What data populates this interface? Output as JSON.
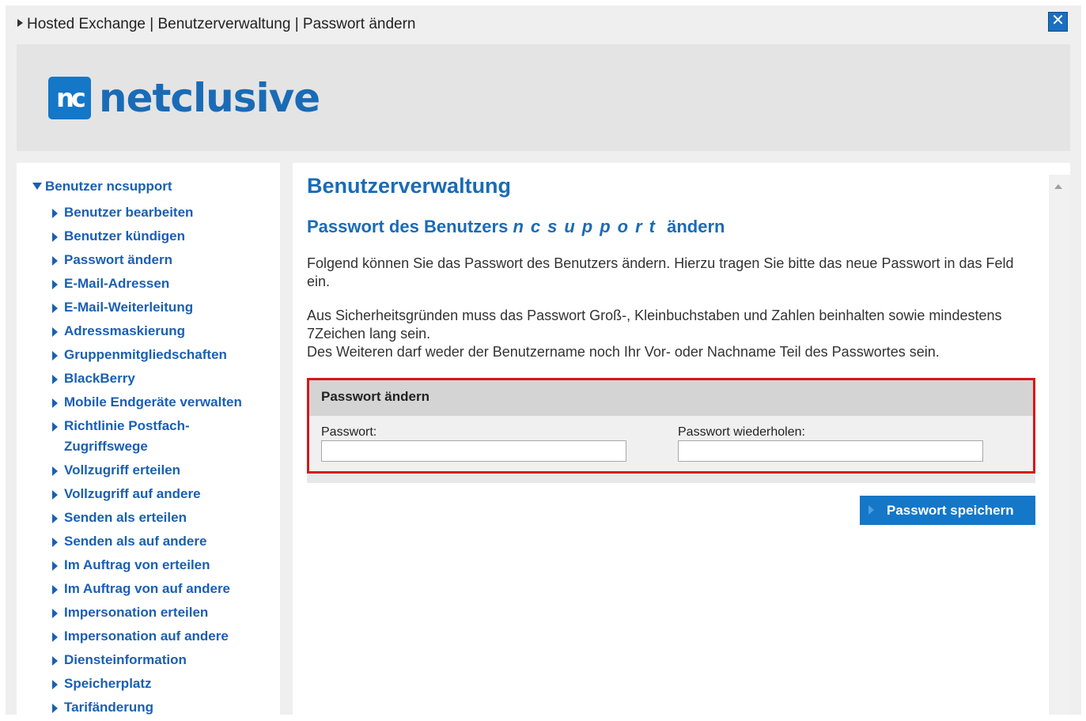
{
  "breadcrumb": "Hosted Exchange | Benutzerverwaltung | Passwort ändern",
  "close_label": "✕",
  "logo": {
    "mark": "nc",
    "text": "netclusive"
  },
  "sidebar": {
    "root_label": "Benutzer ncsupport",
    "items": [
      "Benutzer bearbeiten",
      "Benutzer kündigen",
      "Passwort ändern",
      "E-Mail-Adressen",
      "E-Mail-Weiterleitung",
      "Adressmaskierung",
      "Gruppenmitgliedschaften",
      "BlackBerry",
      "Mobile Endgeräte verwalten",
      "Richtlinie Postfach-Zugriffswege",
      "Vollzugriff erteilen",
      "Vollzugriff auf andere",
      "Senden als erteilen",
      "Senden als auf andere",
      "Im Auftrag von erteilen",
      "Im Auftrag von auf andere",
      "Impersonation erteilen",
      "Impersonation auf andere",
      "Diensteinformation",
      "Speicherplatz",
      "Tarifänderung"
    ]
  },
  "main": {
    "title": "Benutzerverwaltung",
    "subtitle_prefix": "Passwort des Benutzers",
    "username": "ncsupport",
    "subtitle_suffix": "ändern",
    "paragraph1": "Folgend können Sie das Passwort des Benutzers ändern. Hierzu tragen Sie bitte das neue Passwort in das Feld ein.",
    "paragraph2a": "Aus Sicherheitsgründen muss das Passwort Groß-, Kleinbuchstaben und Zahlen beinhalten sowie mindestens 7Zeichen lang sein.",
    "paragraph2b": "Des Weiteren darf weder der Benutzername noch Ihr Vor- oder Nachname Teil des Passwortes sein.",
    "form": {
      "header": "Passwort ändern",
      "password_label": "Passwort:",
      "password_value": "",
      "repeat_label": "Passwort wiederholen:",
      "repeat_value": ""
    },
    "save_label": "Passwort speichern"
  },
  "colors": {
    "accent": "#1477c8",
    "link": "#1a5fb4",
    "highlight_border": "#d9151c"
  }
}
